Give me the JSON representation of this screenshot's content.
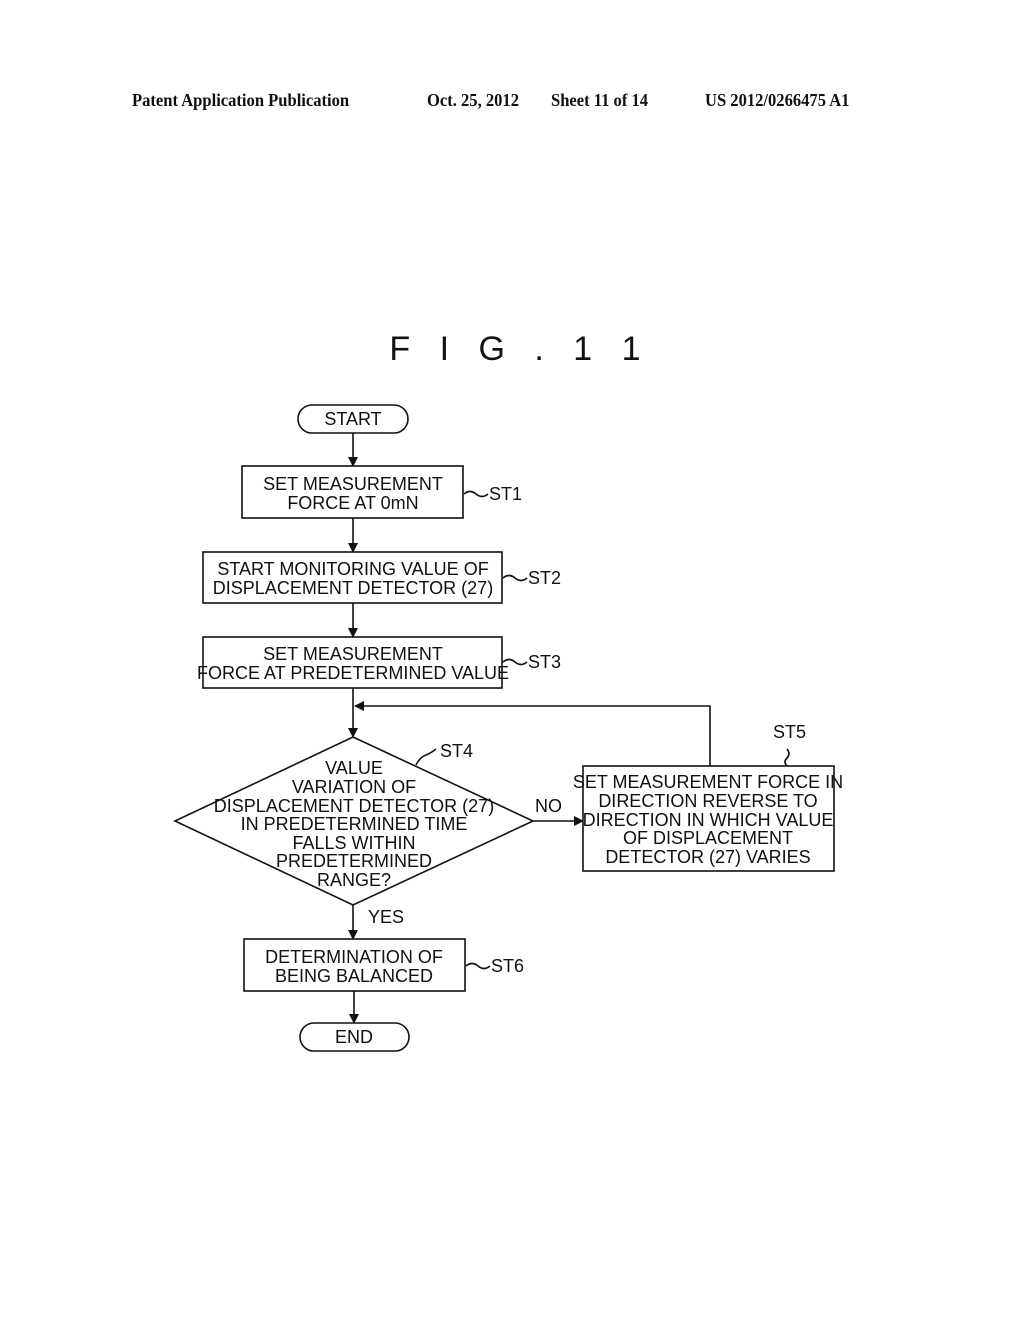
{
  "header": {
    "publication": "Patent Application Publication",
    "date": "Oct. 25, 2012",
    "sheet": "Sheet 11 of 14",
    "number": "US 2012/0266475 A1"
  },
  "figure": {
    "title": "F I G . 1 1"
  },
  "flowchart": {
    "start": "START",
    "end": "END",
    "steps": {
      "st1": {
        "label": "ST1",
        "lines": [
          "SET MEASUREMENT",
          "FORCE AT 0mN"
        ]
      },
      "st2": {
        "label": "ST2",
        "lines": [
          "START MONITORING VALUE OF",
          "DISPLACEMENT DETECTOR (27)"
        ]
      },
      "st3": {
        "label": "ST3",
        "lines": [
          "SET MEASUREMENT",
          "FORCE AT PREDETERMINED VALUE"
        ]
      },
      "st4": {
        "label": "ST4",
        "lines": [
          "VALUE",
          "VARIATION OF",
          "DISPLACEMENT DETECTOR (27)",
          "IN PREDETERMINED TIME",
          "FALLS WITHIN",
          "PREDETERMINED",
          "RANGE?"
        ]
      },
      "st5": {
        "label": "ST5",
        "lines": [
          "SET MEASUREMENT FORCE IN",
          "DIRECTION REVERSE TO",
          "DIRECTION IN WHICH VALUE",
          "OF DISPLACEMENT",
          "DETECTOR (27) VARIES"
        ]
      },
      "st6": {
        "label": "ST6",
        "lines": [
          "DETERMINATION OF",
          "BEING BALANCED"
        ]
      }
    },
    "branches": {
      "no": "NO",
      "yes": "YES"
    }
  }
}
